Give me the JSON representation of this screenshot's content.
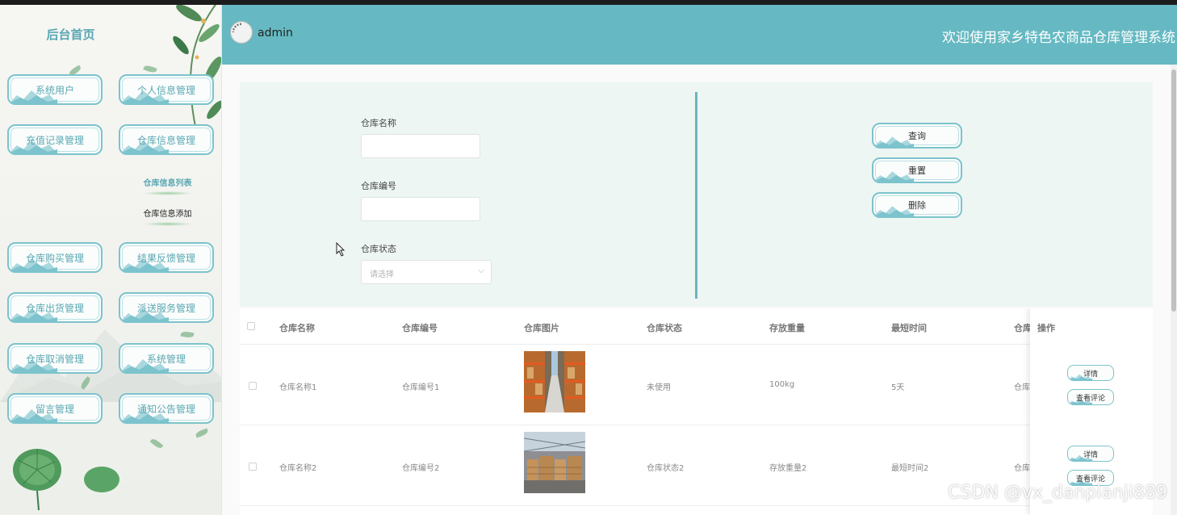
{
  "sidebar": {
    "title": "后台首页",
    "menu": [
      {
        "label": "系统用户"
      },
      {
        "label": "个人信息管理"
      },
      {
        "label": "充值记录管理"
      },
      {
        "label": "仓库信息管理"
      },
      {
        "label": "仓库购买管理"
      },
      {
        "label": "结果反馈管理"
      },
      {
        "label": "仓库出货管理"
      },
      {
        "label": "派送服务管理"
      },
      {
        "label": "仓库取消管理"
      },
      {
        "label": "系统管理"
      },
      {
        "label": "留言管理"
      },
      {
        "label": "通知公告管理"
      }
    ],
    "submenu": [
      {
        "label": "仓库信息列表"
      },
      {
        "label": "仓库信息添加"
      }
    ]
  },
  "header": {
    "username": "admin",
    "welcome": "欢迎使用家乡特色农商品仓库管理系统"
  },
  "search": {
    "name_label": "仓库名称",
    "code_label": "仓库编号",
    "status_label": "仓库状态",
    "status_placeholder": "请选择",
    "query_label": "查询",
    "reset_label": "重置",
    "delete_label": "删除"
  },
  "table": {
    "columns": [
      "仓库名称",
      "仓库编号",
      "仓库图片",
      "仓库状态",
      "存放重量",
      "最短时间",
      "仓库",
      "操作"
    ],
    "rows": [
      {
        "name": "仓库名称1",
        "code": "仓库编号1",
        "status": "未使用",
        "weight": "100kg",
        "time": "5天",
        "extra": "仓库"
      },
      {
        "name": "仓库名称2",
        "code": "仓库编号2",
        "status": "仓库状态2",
        "weight": "存放重量2",
        "time": "最短时间2",
        "extra": "仓库"
      }
    ],
    "detail_label": "详情",
    "review_label": "查看评论"
  },
  "watermark": "CSDN @vx_danpianji889",
  "colors": {
    "header": "#66b9c2",
    "accent": "#7cc3cd",
    "panel": "#eef6f3"
  }
}
